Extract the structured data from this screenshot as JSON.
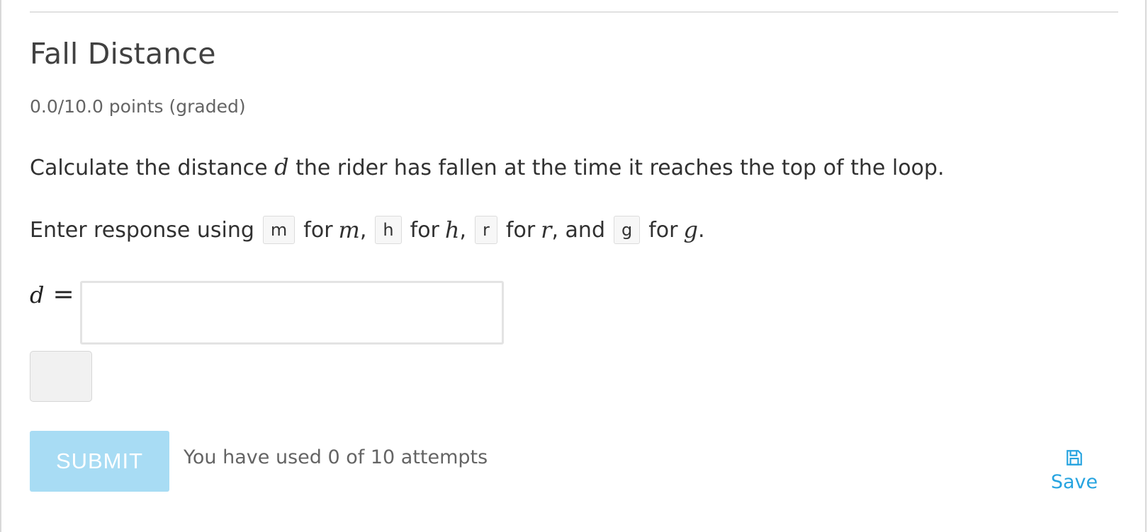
{
  "problem": {
    "title": "Fall Distance",
    "score": "0.0/10.0 points (graded)",
    "question": {
      "before": "Calculate the distance",
      "variable": "d",
      "after": "the rider has fallen at the time it reaches the top of the loop."
    },
    "instruction": {
      "prefix": "Enter response using",
      "for_word": "for",
      "items": [
        {
          "code": "m",
          "symbol": "m",
          "sep": ","
        },
        {
          "code": "h",
          "symbol": "h",
          "sep": ","
        },
        {
          "code": "r",
          "symbol": "r",
          "sep": ", and"
        },
        {
          "code": "g",
          "symbol": "g",
          "sep": "."
        }
      ]
    },
    "answer": {
      "label_variable": "d",
      "label_equals": "=",
      "value": "",
      "placeholder": ""
    }
  },
  "actions": {
    "submit_label": "SUBMIT",
    "attempts_text": "You have used 0 of 10 attempts",
    "save_label": "Save"
  },
  "colors": {
    "submit_bg": "#a8dcf4",
    "save_accent": "#27a4e0"
  },
  "icons": {
    "save": "floppy-disk-icon"
  }
}
